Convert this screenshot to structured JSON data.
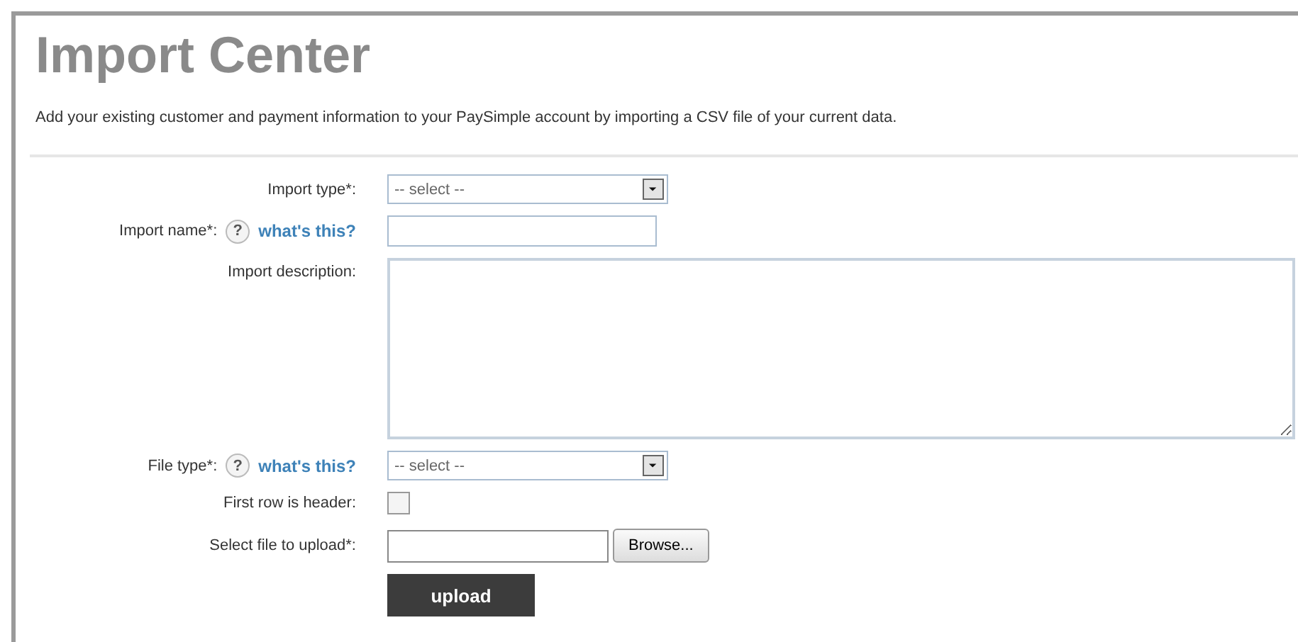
{
  "title": "Import Center",
  "description": "Add your existing customer and payment information to your PaySimple account by importing a CSV file of your current data.",
  "fields": [
    {
      "kind": "select",
      "label": "Import type*:",
      "value": "-- select --"
    },
    {
      "kind": "text",
      "label": "Import name*:",
      "help": "?",
      "help_link": "what's this?"
    },
    {
      "kind": "textarea",
      "label": "Import description:"
    },
    {
      "kind": "select",
      "label": "File type*:",
      "help": "?",
      "help_link": "what's this?",
      "value": "-- select --"
    },
    {
      "kind": "checkbox",
      "label": "First row is header:",
      "checked": false
    },
    {
      "kind": "file",
      "label": "Select file to upload*:",
      "button": "Browse..."
    }
  ],
  "submit": "upload"
}
